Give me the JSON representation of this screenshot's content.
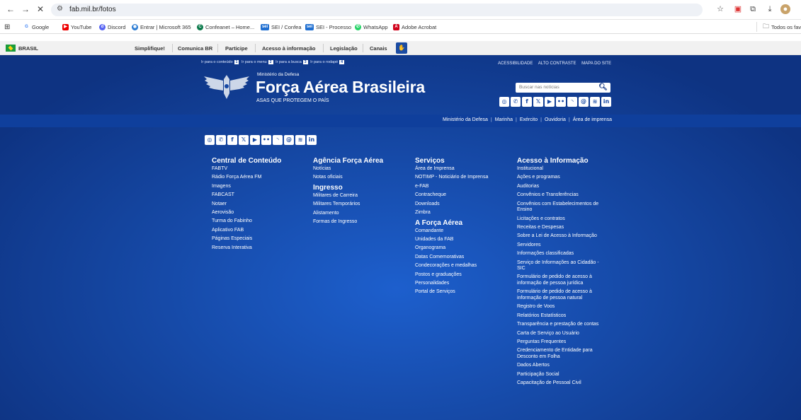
{
  "browser": {
    "url": "fab.mil.br/fotos",
    "bookmarks": [
      "Google",
      "YouTube",
      "Discord",
      "Entrar | Microsoft 365",
      "Confeanet – Home...",
      "SEI / Confea",
      "SEI - Processo",
      "WhatsApp",
      "Adobe Acrobat"
    ],
    "bookmarks_folder": "Todos os fav"
  },
  "gov_bar": {
    "country": "BRASIL",
    "links": [
      "Simplifique!",
      "Comunica BR",
      "Participe",
      "Acesso à informação",
      "Legislação",
      "Canais"
    ]
  },
  "header": {
    "skip_links": [
      {
        "label": "Ir para o conteúdo",
        "key": "1"
      },
      {
        "label": "Ir para o menu",
        "key": "2"
      },
      {
        "label": "Ir para a busca",
        "key": "3"
      },
      {
        "label": "Ir para o rodapé",
        "key": "4"
      }
    ],
    "accessibility_links": [
      "ACESSIBILIDADE",
      "ALTO CONTRASTE",
      "MAPA DO SITE"
    ],
    "ministry": "Ministério da Defesa",
    "title": "Força Aérea Brasileira",
    "tagline": "ASAS QUE PROTEGEM O PAÍS",
    "search_placeholder": "Buscar nas notícias",
    "social_icons": [
      "instagram-icon",
      "whatsapp-icon",
      "facebook-icon",
      "x-icon",
      "youtube-icon",
      "flickr-icon",
      "rss-icon",
      "threads-icon",
      "spotify-icon",
      "linkedin-icon"
    ]
  },
  "main_nav": [
    "Ministério da Defesa",
    "Marinha",
    "Exército",
    "Ouvidoria",
    "Área de imprensa"
  ],
  "footer": {
    "col1": {
      "heading": "Central de Conteúdo",
      "items": [
        "FABTV",
        "Rádio Força Aérea FM",
        "Imagens",
        "FABCAST",
        "Notaer",
        "Aerovisão",
        "Turma do Fabinho",
        "Aplicativo FAB",
        "Páginas Especiais",
        "Reserva Interativa"
      ]
    },
    "col2": {
      "heading": "Agência Força Aérea",
      "items": [
        "Notícias",
        "Notas oficiais"
      ],
      "heading2": "Ingresso",
      "items2": [
        "Militares de Carreira",
        "Militares Temporários",
        "Alistamento",
        "Formas de Ingresso"
      ]
    },
    "col3": {
      "heading": "Serviços",
      "items": [
        "Área de Imprensa",
        "NOTIMP - Noticiário de Imprensa",
        "e-FAB",
        "Contracheque",
        "Downloads",
        "Zimbra"
      ],
      "heading2": "A Força Aérea",
      "items2": [
        "Comandante",
        "Unidades da FAB",
        "Organograma",
        "Datas Comemorativas",
        "Condecorações e medalhas",
        "Postos e graduações",
        "Personalidades",
        "Portal de Serviços"
      ]
    },
    "col4": {
      "heading": "Acesso à Informação",
      "items": [
        "Institucional",
        "Ações e programas",
        "Auditorias",
        "Convênios e Transferências",
        "Convênios com Estabelecimentos de Ensino",
        "Licitações e contratos",
        "Receitas e Despesas",
        "Sobre a Lei de Acesso à Informação",
        "Servidores",
        "Informações classificadas",
        "Serviço de Informações ao Cidadão - SIC",
        "Formulário de pedido de acesso à informação de pessoa jurídica",
        "Formulário de pedido de acesso à informação de pessoa natural",
        "Registro de Voos",
        "Relatórios Estatísticos",
        "Transparência e prestação de contas",
        "Carta de Serviço ao Usuário",
        "Perguntas Frequentes",
        "Credenciamento de Entidade para Desconto em Folha",
        "Dados Abertos",
        "Participação Social",
        "Capacitação de Pessoal Civil"
      ]
    }
  }
}
